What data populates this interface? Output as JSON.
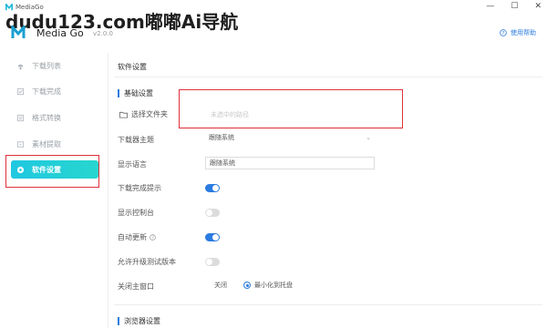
{
  "titlebar": {
    "app_name": "MediaGo",
    "minimize": "—",
    "maximize": "☐",
    "close": "✕"
  },
  "watermark": "dudu123.com嘟嘟Ai导航",
  "header": {
    "brand": "Media Go",
    "version": "v2.0.0",
    "help_label": "使用帮助"
  },
  "sidebar": {
    "items": [
      {
        "label": "下载列表",
        "icon": "download-icon",
        "active": false
      },
      {
        "label": "下载完成",
        "icon": "check-list-icon",
        "active": false
      },
      {
        "label": "格式转换",
        "icon": "convert-icon",
        "active": false
      },
      {
        "label": "素材提取",
        "icon": "extract-icon",
        "active": false
      },
      {
        "label": "软件设置",
        "icon": "settings-icon",
        "active": true
      }
    ]
  },
  "main": {
    "page_title": "软件设置",
    "basic_settings_title": "基础设置",
    "select_folder_label": "选择文件夹",
    "folder_placeholder": "未选中的路径",
    "download_theme_label": "下载器主题",
    "download_theme_value": "跟随系统",
    "display_language_label": "显示语言",
    "display_language_value": "跟随系统",
    "download_complete_tip_label": "下载完成提示",
    "download_complete_tip_on": true,
    "show_console_label": "显示控制台",
    "show_console_on": false,
    "auto_update_label": "自动更新",
    "auto_update_on": true,
    "allow_beta_label": "允许升级测试版本",
    "allow_beta_on": false,
    "close_main_window_label": "关闭主窗口",
    "close_option_quit": "关闭",
    "close_option_tray": "最小化到托盘",
    "browser_settings_title": "浏览器设置"
  },
  "colors": {
    "accent": "#2b7be0",
    "active_nav_start": "#1fc8e0",
    "active_nav_end": "#27d6cf",
    "annotation_red": "#e0303a"
  }
}
